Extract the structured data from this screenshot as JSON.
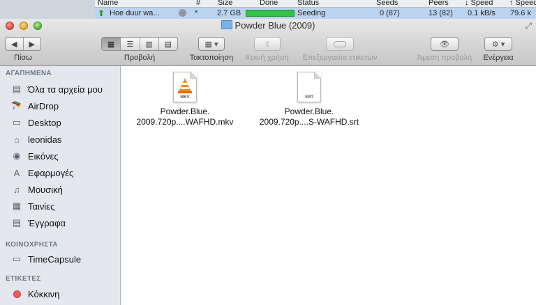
{
  "background_app": {
    "columns": {
      "name": "Name",
      "hash": "#",
      "size": "Size",
      "done": "Done",
      "status": "Status",
      "seeds": "Seeds",
      "peers": "Peers",
      "down": "↓ Speed",
      "up": "↑ Speed"
    },
    "row": {
      "name": "Hoe duur wa...",
      "hash": "*",
      "size": "2.7 GB",
      "done_progress": 1.0,
      "status": "Seeding",
      "seeds": "0 (87)",
      "peers": "13 (82)",
      "down": "0.1 kB/s",
      "up": "79.6 k"
    }
  },
  "window": {
    "title": "Powder Blue (2009)",
    "toolbar": {
      "back_label": "Πίσω",
      "view_label": "Προβολή",
      "arrange_label": "Τακτοποίηση",
      "share_label": "Κοινή χρήση",
      "tags_label": "Επεξεργασία ετικετών",
      "quicklook_label": "Άμεση προβολή",
      "action_label": "Ενέργεια"
    },
    "sidebar": {
      "favorites_header": "ΑΓΑΠΗΜΕΝΑ",
      "favorites": [
        {
          "label": "Όλα τα αρχεία μου",
          "icon": "all-files-icon"
        },
        {
          "label": "AirDrop",
          "icon": "airdrop-icon"
        },
        {
          "label": "Desktop",
          "icon": "desktop-icon"
        },
        {
          "label": "leonidas",
          "icon": "home-icon"
        },
        {
          "label": "Εικόνες",
          "icon": "camera-icon"
        },
        {
          "label": "Εφαρμογές",
          "icon": "applications-icon"
        },
        {
          "label": "Μουσική",
          "icon": "music-icon"
        },
        {
          "label": "Ταινίες",
          "icon": "movies-icon"
        },
        {
          "label": "Έγγραφα",
          "icon": "documents-icon"
        }
      ],
      "shared_header": "ΚΟΙΝΟΧΡΗΣΤΑ",
      "shared": [
        {
          "label": "TimeCapsule",
          "icon": "timecapsule-icon"
        }
      ],
      "tags_header": "ΕΤΙΚΕΤΕΣ",
      "tags": [
        {
          "label": "Κόκκινη",
          "color": "#f25c5c"
        }
      ]
    },
    "files": [
      {
        "line1": "Powder.Blue.",
        "line2": "2009.720p....WAFHD.mkv",
        "badge": "MKV",
        "icon": "vlc-cone-icon"
      },
      {
        "line1": "Powder.Blue.",
        "line2": "2009.720p....S-WAFHD.srt",
        "badge": "SRT",
        "icon": "document-icon"
      }
    ]
  }
}
